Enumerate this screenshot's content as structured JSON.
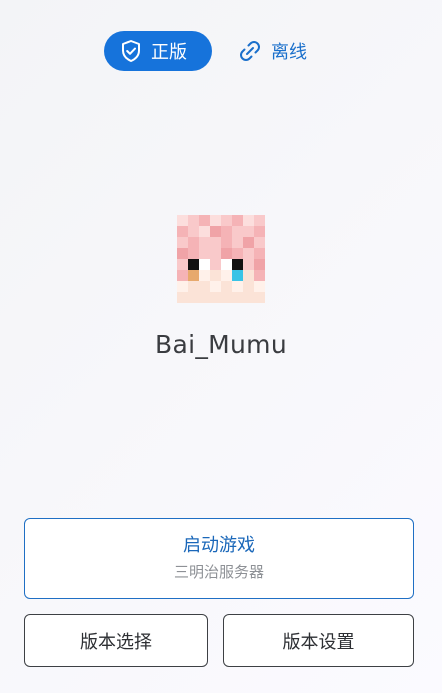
{
  "login_modes": {
    "online": {
      "label": "正版",
      "icon": "shield-check-icon",
      "active": true
    },
    "offline": {
      "label": "离线",
      "icon": "link-broken-icon",
      "active": false
    }
  },
  "player": {
    "name": "Bai_Mumu",
    "avatar": "player-skin-head-icon"
  },
  "launch": {
    "title": "启动游戏",
    "subtitle": "三明治服务器"
  },
  "actions": {
    "version_select": "版本选择",
    "version_settings": "版本设置"
  },
  "colors": {
    "accent": "#1673db",
    "accent_text": "#1a6fcb",
    "text_dark": "#3a3c40",
    "text_muted": "#8e9196"
  }
}
